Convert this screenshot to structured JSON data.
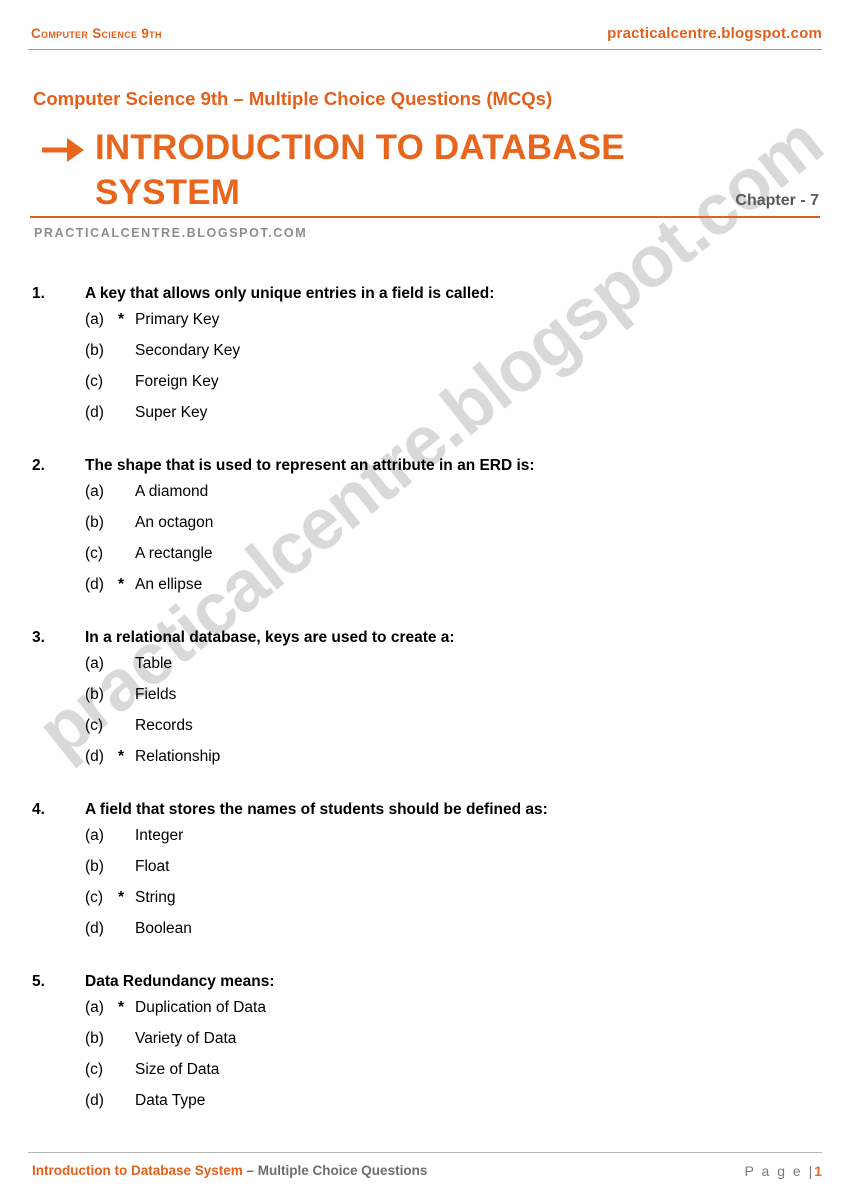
{
  "header": {
    "left_label": "Computer Science 9th",
    "right_label": "practicalcentre.blogspot.com"
  },
  "title_block": {
    "subject_line": "Computer Science 9th – Multiple Choice Questions (MCQs)",
    "arrow_icon": "arrow-right-icon",
    "chapter_title": "INTRODUCTION TO DATABASE SYSTEM",
    "chapter_number": "Chapter - 7",
    "site_line": "PRACTICALCENTRE.BLOGSPOT.COM"
  },
  "watermark": {
    "text": "practicalcentre.blogspot.com"
  },
  "colors": {
    "orange": "#e8651e",
    "orange_dark": "#e2601b",
    "gray_text": "#6e6e6e",
    "watermark_gray": "#d9d9d9"
  },
  "questions": [
    {
      "number": "1.",
      "text": "A key that allows only unique entries in a field is called:",
      "options": [
        {
          "label": "(a)",
          "marker": "*",
          "text": "Primary Key"
        },
        {
          "label": "(b)",
          "marker": "",
          "text": "Secondary Key"
        },
        {
          "label": "(c)",
          "marker": "",
          "text": "Foreign Key"
        },
        {
          "label": "(d)",
          "marker": "",
          "text": "Super Key"
        }
      ]
    },
    {
      "number": "2.",
      "text": "The shape that is used to represent an attribute in an ERD is:",
      "options": [
        {
          "label": "(a)",
          "marker": "",
          "text": "A diamond"
        },
        {
          "label": "(b)",
          "marker": "",
          "text": "An octagon"
        },
        {
          "label": "(c)",
          "marker": "",
          "text": "A rectangle"
        },
        {
          "label": "(d)",
          "marker": "*",
          "text": "An ellipse"
        }
      ]
    },
    {
      "number": "3.",
      "text": "In a relational database, keys are used to create a:",
      "options": [
        {
          "label": "(a)",
          "marker": "",
          "text": "Table"
        },
        {
          "label": "(b)",
          "marker": "",
          "text": "Fields"
        },
        {
          "label": "(c)",
          "marker": "",
          "text": "Records"
        },
        {
          "label": "(d)",
          "marker": "*",
          "text": "Relationship"
        }
      ]
    },
    {
      "number": "4.",
      "text": "A field that stores the names of students should be defined as:",
      "options": [
        {
          "label": "(a)",
          "marker": "",
          "text": "Integer"
        },
        {
          "label": "(b)",
          "marker": "",
          "text": "Float"
        },
        {
          "label": "(c)",
          "marker": "*",
          "text": "String"
        },
        {
          "label": "(d)",
          "marker": "",
          "text": "Boolean"
        }
      ]
    },
    {
      "number": "5.",
      "text": "Data Redundancy means:",
      "options": [
        {
          "label": "(a)",
          "marker": "*",
          "text": "Duplication of Data"
        },
        {
          "label": "(b)",
          "marker": "",
          "text": "Variety of Data"
        },
        {
          "label": "(c)",
          "marker": "",
          "text": "Size of Data"
        },
        {
          "label": "(d)",
          "marker": "",
          "text": "Data Type"
        }
      ]
    }
  ],
  "footer": {
    "title_orange": "Introduction to Database System",
    "title_gray": " – Multiple Choice Questions",
    "page_label": "P a g e |",
    "page_number": "1"
  }
}
